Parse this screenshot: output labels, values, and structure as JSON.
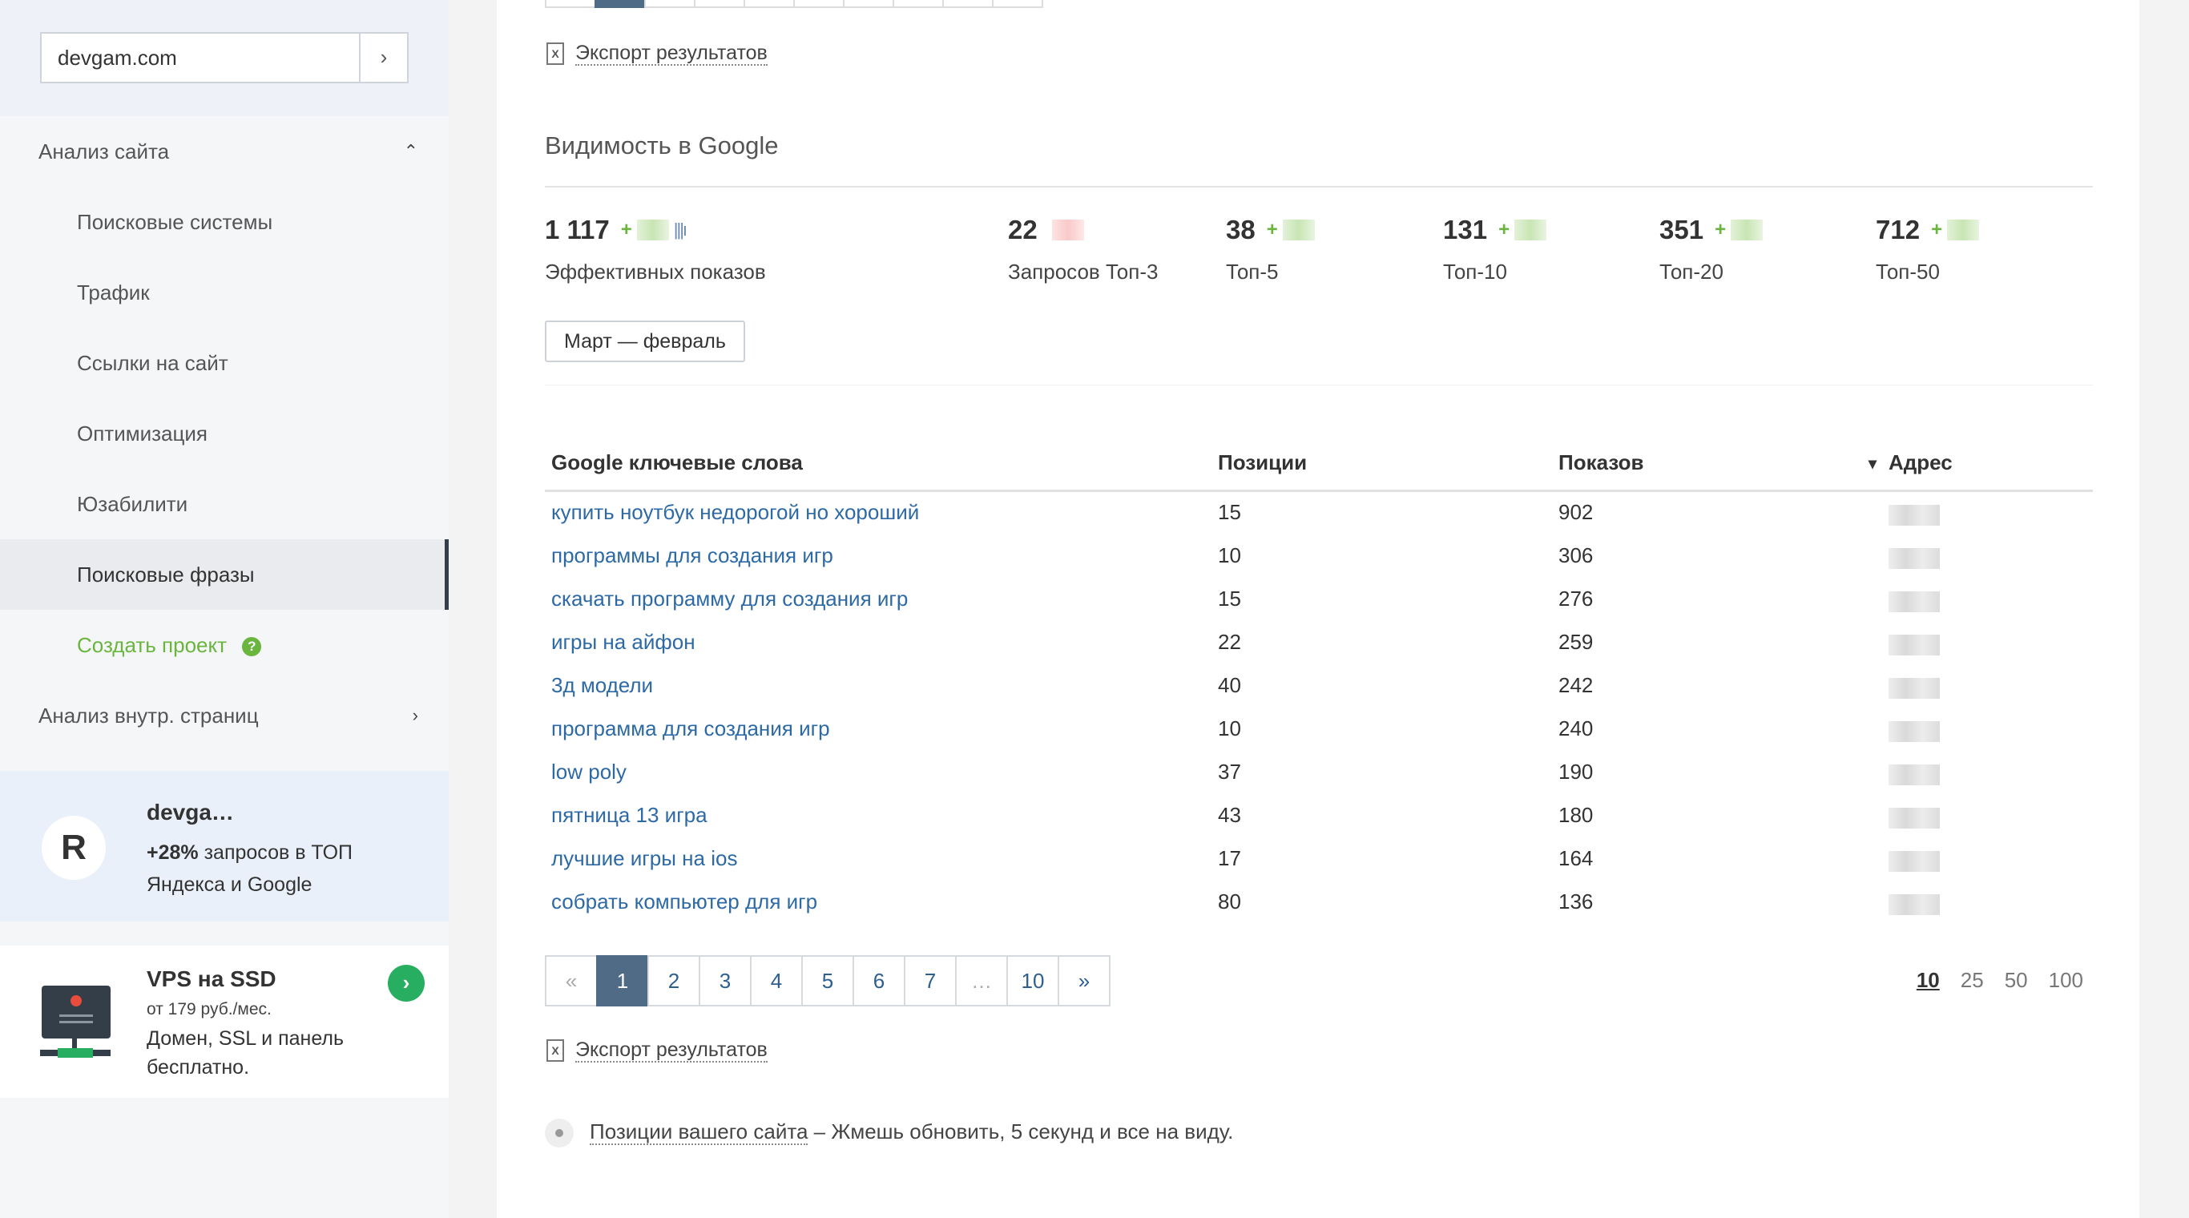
{
  "sidebar": {
    "domain_value": "devgam.com",
    "go_label": "›",
    "section1": "Анализ сайта",
    "items": [
      "Поисковые системы",
      "Трафик",
      "Ссылки на сайт",
      "Оптимизация",
      "Юзабилити",
      "Поисковые фразы"
    ],
    "create_project": "Создать проект",
    "help_mark": "?",
    "section2": "Анализ внутр. страниц",
    "promo1": {
      "logo": "R",
      "title": "devga…",
      "highlight": "+28%",
      "text": " запросов в ТОП Яндекса и Google"
    },
    "promo2": {
      "title": "VPS на SSD",
      "price": "от 179 руб./мес.",
      "text": "Домен, SSL и панель бесплатно.",
      "go": "›"
    }
  },
  "main": {
    "export_label": "Экспорт результатов",
    "export_icon": "X",
    "visibility_title": "Видимость в Google",
    "stats": [
      {
        "value": "1 117",
        "label": "Эффективных показов",
        "plus": "+"
      },
      {
        "value": "22",
        "label": "Запросов Топ-3",
        "plus": ""
      },
      {
        "value": "38",
        "label": "Топ-5",
        "plus": "+"
      },
      {
        "value": "131",
        "label": "Топ-10",
        "plus": "+"
      },
      {
        "value": "351",
        "label": "Топ-20",
        "plus": "+"
      },
      {
        "value": "712",
        "label": "Топ-50",
        "plus": "+"
      }
    ],
    "bars_glyph": "|||ı",
    "period": "Март — февраль",
    "table": {
      "headers": {
        "keyword": "Google ключевые слова",
        "positions": "Позиции",
        "impressions": "Показов",
        "address": "Адрес",
        "sort_arrow": "▾"
      },
      "rows": [
        {
          "keyword": "купить ноутбук недорогой но хороший",
          "position": "15",
          "impressions": "902"
        },
        {
          "keyword": "программы для создания игр",
          "position": "10",
          "impressions": "306"
        },
        {
          "keyword": "скачать программу для создания игр",
          "position": "15",
          "impressions": "276"
        },
        {
          "keyword": "игры на айфон",
          "position": "22",
          "impressions": "259"
        },
        {
          "keyword": "3д модели",
          "position": "40",
          "impressions": "242"
        },
        {
          "keyword": "программа для создания игр",
          "position": "10",
          "impressions": "240"
        },
        {
          "keyword": "low poly",
          "position": "37",
          "impressions": "190"
        },
        {
          "keyword": "пятница 13 игра",
          "position": "43",
          "impressions": "180"
        },
        {
          "keyword": "лучшие игры на ios",
          "position": "17",
          "impressions": "164"
        },
        {
          "keyword": "собрать компьютер для игр",
          "position": "80",
          "impressions": "136"
        }
      ]
    },
    "pager": [
      "«",
      "1",
      "2",
      "3",
      "4",
      "5",
      "6",
      "7",
      "…",
      "10",
      "»"
    ],
    "per_page": [
      "10",
      "25",
      "50",
      "100"
    ],
    "note_link": "Позиции вашего сайта",
    "note_text": " – Жмешь обновить, 5 секунд и все на виду."
  }
}
